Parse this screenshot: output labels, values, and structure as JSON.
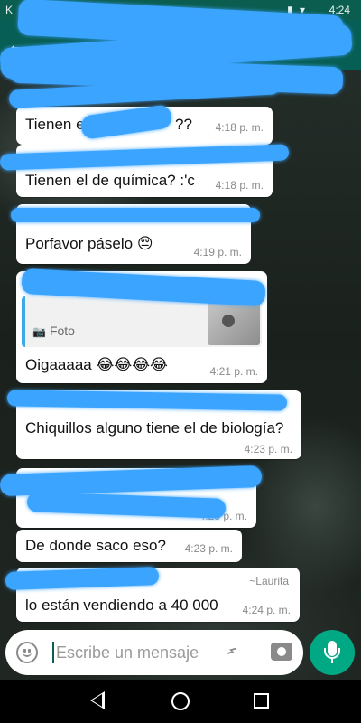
{
  "colors": {
    "header": "#075e54",
    "bubble": "#ffffff",
    "redaction": "#3ba4ff",
    "mic_button": "#00a884",
    "quote_bar": "#3da9e6"
  },
  "status_bar": {
    "left": "K",
    "time": "4:24"
  },
  "header": {
    "back_icon": "arrow-left-icon",
    "menu_icon": "more-vert-icon"
  },
  "messages": [
    {
      "text": "Tienen el d",
      "trail": "??",
      "time": "4:18 p. m."
    },
    {
      "text": "Tienen el de química? :'c",
      "time": "4:18 p. m."
    },
    {
      "text": "Porfavor páselo",
      "emoji": "😔",
      "time": "4:19 p. m."
    },
    {
      "quote_label": "Foto",
      "quote_icon": "camera-icon",
      "text": "Oigaaaaa",
      "emoji": "😂😂😂😂",
      "time": "4:21 p. m."
    },
    {
      "text": "Chiquillos alguno tiene el de biología?",
      "time": "4:23 p. m."
    },
    {
      "time": "4:23 p. m."
    },
    {
      "text": "De donde saco eso?",
      "time": "4:23 p. m."
    },
    {
      "sender": "~Laurita",
      "text": "lo están vendiendo a 40 000",
      "time": "4:24 p. m."
    }
  ],
  "composer": {
    "placeholder": "Escribe un mensaje",
    "emoji_icon": "emoji-icon",
    "attach_icon": "paperclip-icon",
    "camera_icon": "camera-icon",
    "mic_icon": "microphone-icon"
  },
  "navigation": {
    "back_icon": "nav-back-icon",
    "home_icon": "nav-home-icon",
    "recent_icon": "nav-recent-icon"
  }
}
